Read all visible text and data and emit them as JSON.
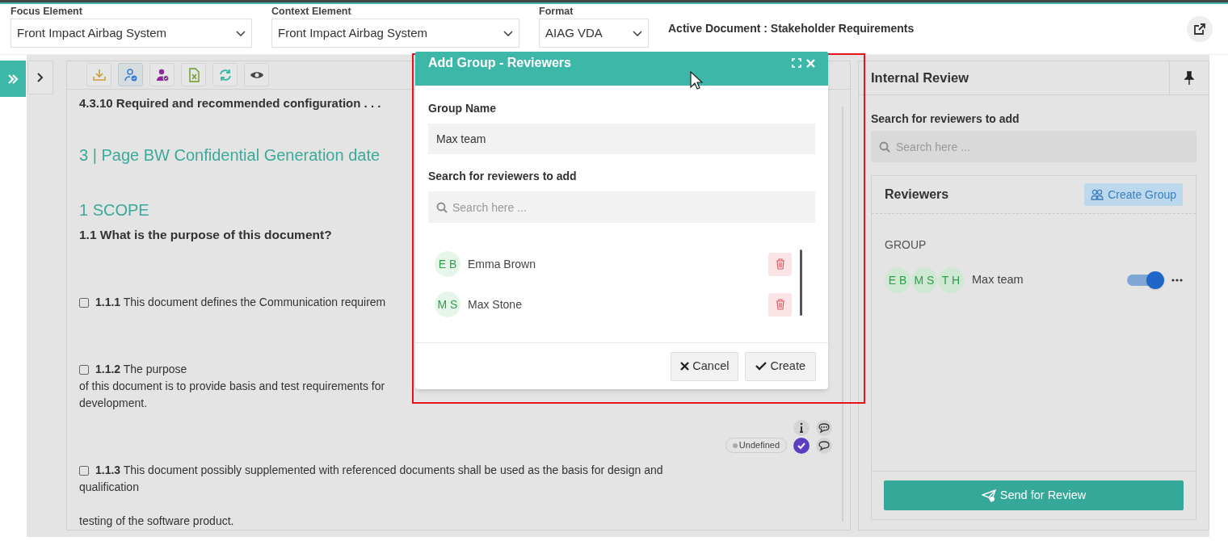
{
  "header": {
    "fields": [
      {
        "label": "Focus Element",
        "value": "Front Impact Airbag System"
      },
      {
        "label": "Context Element",
        "value": "Front Impact Airbag System"
      },
      {
        "label": "Format",
        "value": "AIAG VDA"
      }
    ],
    "active_document": "Active Document : Stakeholder Requirements"
  },
  "toolbar": [
    {
      "kind": "download",
      "selected": false
    },
    {
      "kind": "user-check",
      "selected": true
    },
    {
      "kind": "user-assign",
      "selected": false
    },
    {
      "kind": "excel",
      "selected": false
    },
    {
      "kind": "refresh",
      "selected": false
    },
    {
      "kind": "eye",
      "selected": false
    }
  ],
  "document": [
    {
      "kind": "cut",
      "text": "4.3.10 Required and recommended configuration . . ."
    },
    {
      "kind": "heading",
      "text": "3 | Page BW Confidential Generation date"
    },
    {
      "kind": "heading",
      "text": "1 SCOPE"
    },
    {
      "kind": "subheading",
      "text": "1.1 What is the purpose of this document?"
    },
    {
      "kind": "requirement",
      "number": "1.1.1",
      "text": "This document defines the Communication requirem",
      "checked": false
    },
    {
      "kind": "requirement",
      "number": "1.1.2",
      "text": "The purpose",
      "checked": false,
      "lines": [
        "of this document is to provide basis and test requirements for",
        "development."
      ],
      "status": "Undefined",
      "approved": true
    },
    {
      "kind": "requirement",
      "number": "1.1.3",
      "text": "This document possibly supplemented with referenced documents shall be used as the basis for design and",
      "checked": false,
      "lines": [
        "qualification"
      ]
    },
    {
      "kind": "paragraph",
      "text": "testing of the software product."
    }
  ],
  "dialog": {
    "title": "Add Group - Reviewers",
    "group_name_label": "Group Name",
    "group_name": "Max team",
    "search_label": "Search for reviewers to add",
    "search_placeholder": "Search here ...",
    "members": [
      {
        "initials": "E B",
        "name": "Emma Brown"
      },
      {
        "initials": "M S",
        "name": "Max Stone"
      }
    ],
    "cancel": "Cancel",
    "create": "Create"
  },
  "review_panel": {
    "title": "Internal Review",
    "search_label": "Search for reviewers to add",
    "search_placeholder": "Search here ...",
    "reviewers_title": "Reviewers",
    "create_group": "Create Group",
    "group_heading": "GROUP",
    "groups": [
      {
        "initials": [
          "E B",
          "M S",
          "T H"
        ],
        "name": "Max team",
        "on": true
      }
    ],
    "send": "Send for Review"
  }
}
